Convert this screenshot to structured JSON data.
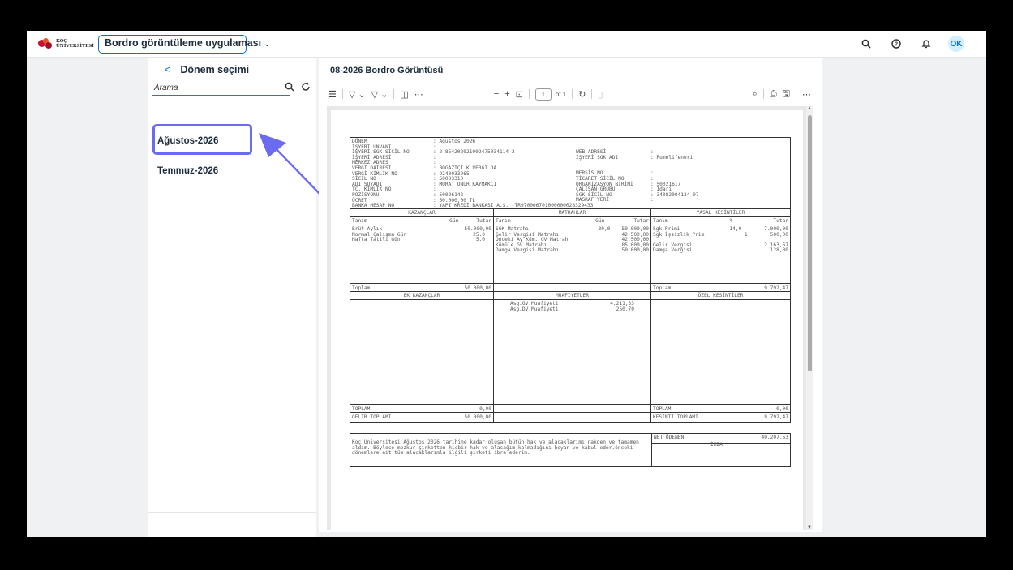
{
  "shell": {
    "logo_line1": "KOÇ",
    "logo_line2": "ÜNİVERSİTESİ",
    "app_title": "Bordro görüntüleme uygulaması",
    "avatar_initials": "OK",
    "icons": [
      "search-icon",
      "help-icon",
      "bell-icon"
    ]
  },
  "left": {
    "header": "Dönem seçimi",
    "search_placeholder": "Arama",
    "items": [
      "Ağustos-2026",
      "Temmuz-2026"
    ],
    "selected": "Ağustos-2026"
  },
  "right": {
    "title": "08-2026 Bordro Görüntüsü",
    "page_current": "1",
    "page_total": "of 1"
  },
  "payslip": {
    "header_left": [
      [
        "DÖNEM",
        ": Ağustos 2026"
      ],
      [
        "İŞYERİ UNVANI",
        ":"
      ],
      [
        "İŞYERİ SGK SİCİL NO",
        ": 2 854202021002475034114 2"
      ],
      [
        "İŞYERİ ADRESİ",
        ":"
      ],
      [
        "MERKEZ ADRES",
        ":"
      ],
      [
        "VERGİ DAİRESİ",
        ": BOĞAZİÇİ K.VERGİ DA."
      ],
      [
        "VERGİ KİMLİK NO",
        ": 9240033265"
      ],
      [
        "SİCİL NO",
        ": 50003310"
      ],
      [
        "ADI SOYADI",
        ": MURAT ONUR KAYMAKCI"
      ],
      [
        "TC. KİMLİK NO",
        ":"
      ],
      [
        "POZİSYONU",
        ": 50026142"
      ],
      [
        "ÜCRET",
        ":      50.000,00  TL"
      ],
      [
        "BANKA HESAP NO",
        ": YAPI KREDİ BANKASI A.Ş. -TR970006701000000028329433"
      ]
    ],
    "header_right": [
      [
        "WEB ADRESİ",
        ":"
      ],
      [
        "İŞYERİ SGK ADI",
        ": Rumelifeneri"
      ],
      [
        "",
        ""
      ],
      [
        "",
        ""
      ],
      [
        "MERSİS NO",
        ":"
      ],
      [
        "TİCARET SİCİL NO",
        ":"
      ],
      [
        "ORGANİZASYON BİRİMİ",
        ": 50021617"
      ],
      [
        "ÇALIŞAN GRUBU",
        ": İdari"
      ],
      [
        "SGK SİCİL NO",
        ": 34082004134 07"
      ],
      [
        "MASRAF YERİ",
        ":"
      ]
    ],
    "earnings": {
      "title": "KAZANÇLAR",
      "cols": [
        "Tanım",
        "Gün",
        "Tutar"
      ],
      "rows": [
        [
          "Brüt Aylık",
          "",
          "50.000,00"
        ],
        [
          "Normal Çalışma Gün",
          "25.0",
          ""
        ],
        [
          "Hafta Tatili Gün",
          "5.0",
          ""
        ]
      ],
      "total_label": "Toplam",
      "total": "50.000,00"
    },
    "bases": {
      "title": "MATRAHLAR",
      "cols": [
        "Tanım",
        "Gün",
        "Tutar"
      ],
      "rows": [
        [
          "SGK Matrahı",
          "30,0",
          "50.000,00"
        ],
        [
          "Gelir Vergisi Matrahı",
          "",
          "42.500,00"
        ],
        [
          "Önceki Ay Küm. GV Matrah",
          "",
          "42.500,00"
        ],
        [
          "Kümüle GV Matrahı",
          "",
          "85.000,00"
        ],
        [
          "Damga Vergisi Matrahı",
          "",
          "50.000,00"
        ]
      ]
    },
    "deductions": {
      "title": "YASAL KESİNTİLER",
      "cols": [
        "Tanım",
        "%",
        "Tutar"
      ],
      "rows": [
        [
          "Sgk Primi",
          "14,0",
          "7.000,00"
        ],
        [
          "Sgk İşsizlik Prim",
          "1",
          "500,00"
        ],
        [
          "",
          "",
          ""
        ],
        [
          "Gelir Vergisi",
          "",
          "2.163,67"
        ],
        [
          "Damga Vergisi",
          "",
          "128,80"
        ]
      ],
      "total_label": "Toplam",
      "total": "9.792,47"
    },
    "extra_earnings": {
      "title": "EK KAZANÇLAR",
      "total_label": "TOPLAM",
      "total": "0,00"
    },
    "exemptions": {
      "title": "MUAFİYETLER",
      "rows": [
        [
          "Asg.GV.Muafiyeti",
          "4.211,33"
        ],
        [
          "Asg.DV.Muafiyeti",
          "250,70"
        ]
      ]
    },
    "special_deductions": {
      "title": "ÖZEL KESİNTİLER",
      "total_label": "TOPLAM",
      "total": "0,00"
    },
    "gross_label": "GELİR TOPLAMI",
    "gross": "50.000,00",
    "deduction_total_label": "KESİNTİ TOPLAMI",
    "deduction_total": "9.792,47",
    "net_label": "NET ÖDENEN",
    "net": "40.207,53",
    "sign_label": "İMZA",
    "statement": "Koç Üniversitesi          Ağustos 2026 tarihine kadar oluşan bütün hak ve alacaklarımı nakden ve tamamen aldım. Böylece mezkur şirketten hiçbir hak ve alacağım kalmadığını beyan ve kabul eder.önceki dönemlere ait tüm alacaklarımla ilgili şirketi ibra ederim."
  },
  "colors": {
    "accent": "#0a6ed1",
    "highlight": "#6a6bf0"
  }
}
